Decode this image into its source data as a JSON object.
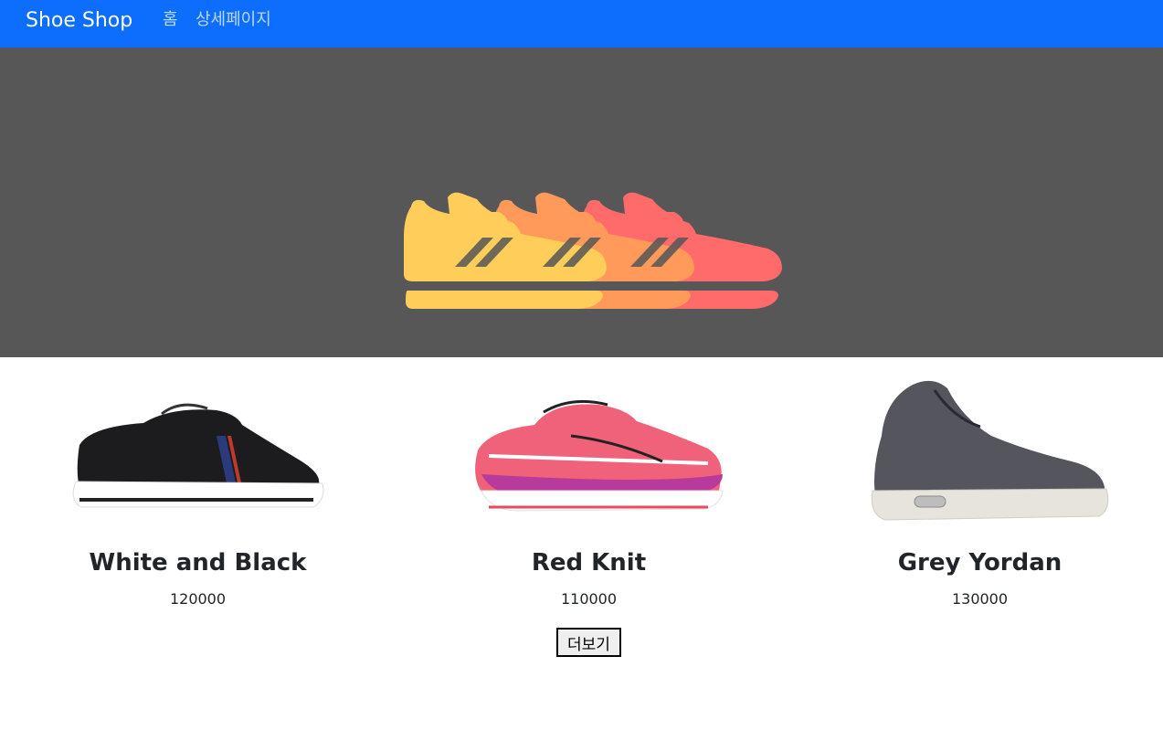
{
  "navbar": {
    "brand": "Shoe Shop",
    "links": [
      {
        "label": "홈"
      },
      {
        "label": "상세페이지"
      }
    ],
    "bg_color": "#0d6efd"
  },
  "hero": {
    "bg_color": "#575757",
    "illustration": "three-sneakers-icon",
    "shoe_colors": [
      "#ffcd5a",
      "#ff9a5a",
      "#ff6b6b"
    ]
  },
  "products": [
    {
      "title": "White and Black",
      "price": "120000",
      "image": "black-canvas-sneaker"
    },
    {
      "title": "Red Knit",
      "price": "110000",
      "image": "pink-running-shoe"
    },
    {
      "title": "Grey Yordan",
      "price": "130000",
      "image": "grey-wool-hightop"
    }
  ],
  "more_button": {
    "label": "더보기"
  }
}
